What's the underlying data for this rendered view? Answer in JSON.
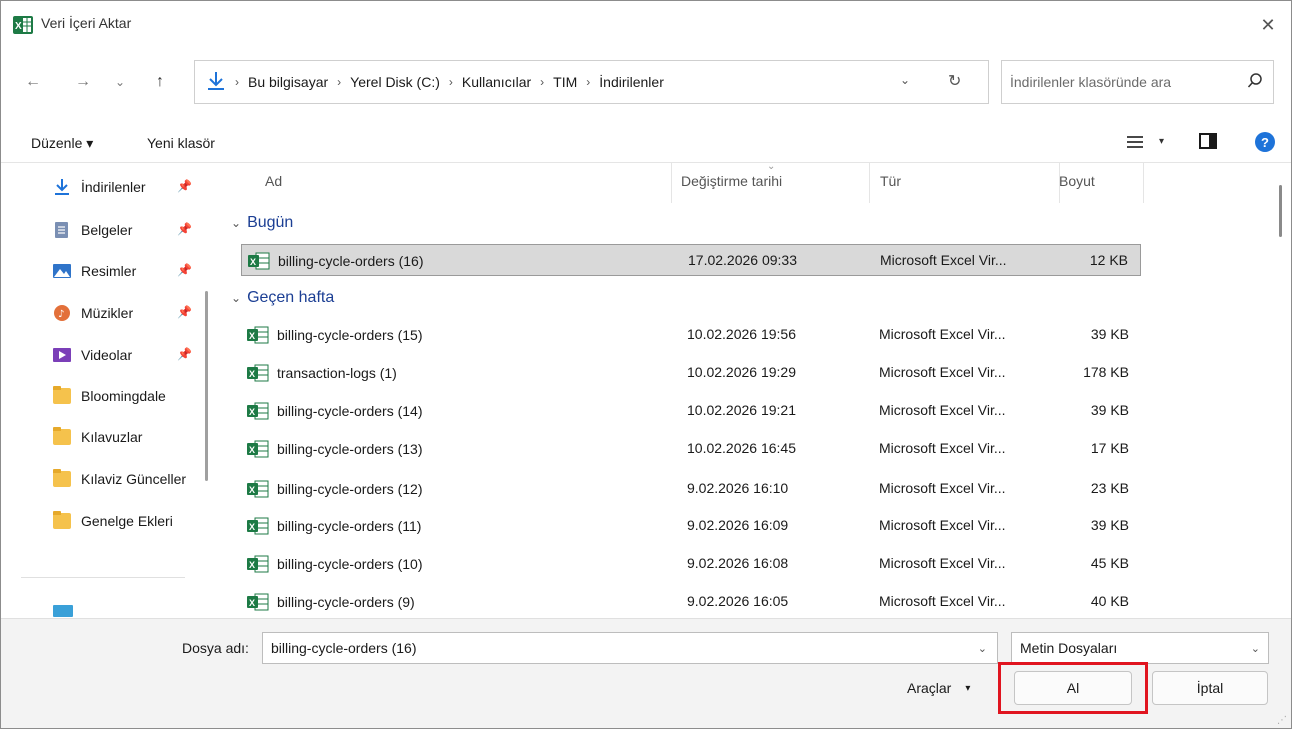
{
  "window": {
    "title": "Veri İçeri Aktar",
    "close_glyph": "✕"
  },
  "nav": {
    "back": "←",
    "forward": "→",
    "history": "⌄",
    "up": "↑"
  },
  "address": {
    "crumbs": [
      "Bu bilgisayar",
      "Yerel Disk (C:)",
      "Kullanıcılar",
      "TIM",
      "İndirilenler"
    ],
    "separator": "›",
    "dropdown": "⌄",
    "refresh": "↻"
  },
  "search": {
    "placeholder": "İndirilenler klasöründe ara"
  },
  "commandbar": {
    "organize": "Düzenle ▾",
    "new_folder": "Yeni klasör",
    "view_caret": "▾",
    "help": "?"
  },
  "sidebar": {
    "items": [
      {
        "label": "İndirilenler",
        "icon": "download-icon",
        "pinned": true
      },
      {
        "label": "Belgeler",
        "icon": "documents-icon",
        "pinned": true
      },
      {
        "label": "Resimler",
        "icon": "pictures-icon",
        "pinned": true
      },
      {
        "label": "Müzikler",
        "icon": "music-icon",
        "pinned": true
      },
      {
        "label": "Videolar",
        "icon": "videos-icon",
        "pinned": true
      },
      {
        "label": "Bloomingdale",
        "icon": "folder-icon",
        "pinned": false
      },
      {
        "label": "Kılavuzlar",
        "icon": "folder-icon",
        "pinned": false
      },
      {
        "label": "Kılaviz Günceller",
        "icon": "folder-icon",
        "pinned": false
      },
      {
        "label": "Genelge Ekleri",
        "icon": "folder-icon",
        "pinned": false
      }
    ],
    "pin_glyph": "📌"
  },
  "columns": {
    "name": "Ad",
    "modified": "Değiştirme tarihi",
    "type": "Tür",
    "size": "Boyut",
    "sort_glyph": "⌄"
  },
  "groups": [
    {
      "label": "Bugün",
      "rows": [
        {
          "name": "billing-cycle-orders (16)",
          "date": "17.02.2026 09:33",
          "type": "Microsoft Excel Vir...",
          "size": "12 KB",
          "selected": true
        }
      ]
    },
    {
      "label": "Geçen hafta",
      "rows": [
        {
          "name": "billing-cycle-orders (15)",
          "date": "10.02.2026 19:56",
          "type": "Microsoft Excel Vir...",
          "size": "39 KB"
        },
        {
          "name": "transaction-logs (1)",
          "date": "10.02.2026 19:29",
          "type": "Microsoft Excel Vir...",
          "size": "178 KB"
        },
        {
          "name": "billing-cycle-orders (14)",
          "date": "10.02.2026 19:21",
          "type": "Microsoft Excel Vir...",
          "size": "39 KB"
        },
        {
          "name": "billing-cycle-orders (13)",
          "date": "10.02.2026 16:45",
          "type": "Microsoft Excel Vir...",
          "size": "17 KB"
        },
        {
          "name": "billing-cycle-orders (12)",
          "date": "9.02.2026 16:10",
          "type": "Microsoft Excel Vir...",
          "size": "23 KB"
        },
        {
          "name": "billing-cycle-orders (11)",
          "date": "9.02.2026 16:09",
          "type": "Microsoft Excel Vir...",
          "size": "39 KB"
        },
        {
          "name": "billing-cycle-orders (10)",
          "date": "9.02.2026 16:08",
          "type": "Microsoft Excel Vir...",
          "size": "45 KB"
        },
        {
          "name": "billing-cycle-orders (9)",
          "date": "9.02.2026 16:05",
          "type": "Microsoft Excel Vir...",
          "size": "40 KB"
        }
      ]
    }
  ],
  "bottom": {
    "filename_label": "Dosya adı:",
    "filename_value": "billing-cycle-orders (16)",
    "filetype_value": "Metin Dosyaları",
    "tools_label": "Araçlar",
    "open_label": "Al",
    "cancel_label": "İptal",
    "caret": "⌄"
  },
  "colors": {
    "accent": "#1e73d9",
    "group_text": "#1c3f94",
    "highlight": "#e0141f",
    "excel_green": "#1d7a45",
    "folder": "#f5c24c"
  }
}
